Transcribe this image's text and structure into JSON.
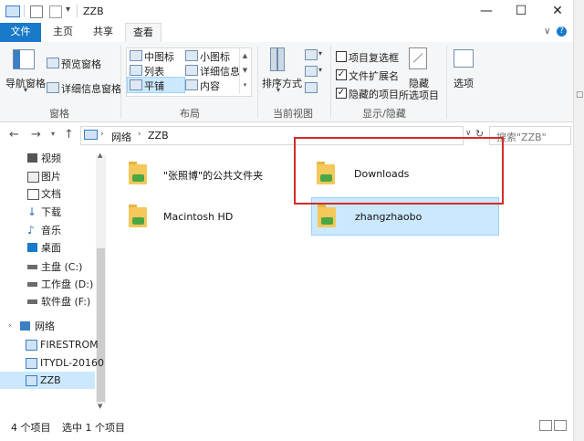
{
  "window": {
    "title": "ZZB"
  },
  "tabs": {
    "file": "文件",
    "home": "主页",
    "share": "共享",
    "view": "查看"
  },
  "ribbon": {
    "pane": {
      "nav_pane": "导航窗格",
      "preview": "预览窗格",
      "details": "详细信息窗格",
      "label": "窗格"
    },
    "layout": {
      "medium_icons": "中图标",
      "small_icons": "小图标",
      "list": "列表",
      "details": "详细信息",
      "tiles": "平铺",
      "content": "内容",
      "label": "布局"
    },
    "current_view": {
      "sort_by": "排序方式",
      "label": "当前视图"
    },
    "show_hide": {
      "item_checkboxes": "项目复选框",
      "item_checkboxes_checked": false,
      "file_extensions": "文件扩展名",
      "file_extensions_checked": true,
      "hidden_items": "隐藏的项目",
      "hidden_items_checked": true,
      "hide_selected": "隐藏",
      "hide_selected_2": "所选项目",
      "label": "显示/隐藏"
    },
    "options": "选项"
  },
  "address": {
    "segment_1": "网络",
    "segment_2": "ZZB"
  },
  "search": {
    "placeholder": "搜索\"ZZB\""
  },
  "nav_pane": {
    "items": [
      {
        "label": "视频"
      },
      {
        "label": "图片"
      },
      {
        "label": "文档"
      },
      {
        "label": "下载"
      },
      {
        "label": "音乐"
      },
      {
        "label": "桌面"
      },
      {
        "label": "主盘 (C:)"
      },
      {
        "label": "工作盘 (D:)"
      },
      {
        "label": "软件盘 (F:)"
      },
      {
        "label": "网络"
      },
      {
        "label": "FIRESTROM"
      },
      {
        "label": "ITYDL-20160"
      },
      {
        "label": "ZZB"
      }
    ]
  },
  "content": {
    "items": [
      {
        "label": "\"张照博\"的公共文件夹"
      },
      {
        "label": "Downloads"
      },
      {
        "label": "Macintosh HD"
      },
      {
        "label": "zhangzhaobo"
      }
    ]
  },
  "status": {
    "count": "4 个项目",
    "selected": "选中 1 个项目"
  },
  "colors": {
    "accent": "#1979ca",
    "selection": "#cce8ff",
    "highlight_box": "#d32b2b"
  }
}
